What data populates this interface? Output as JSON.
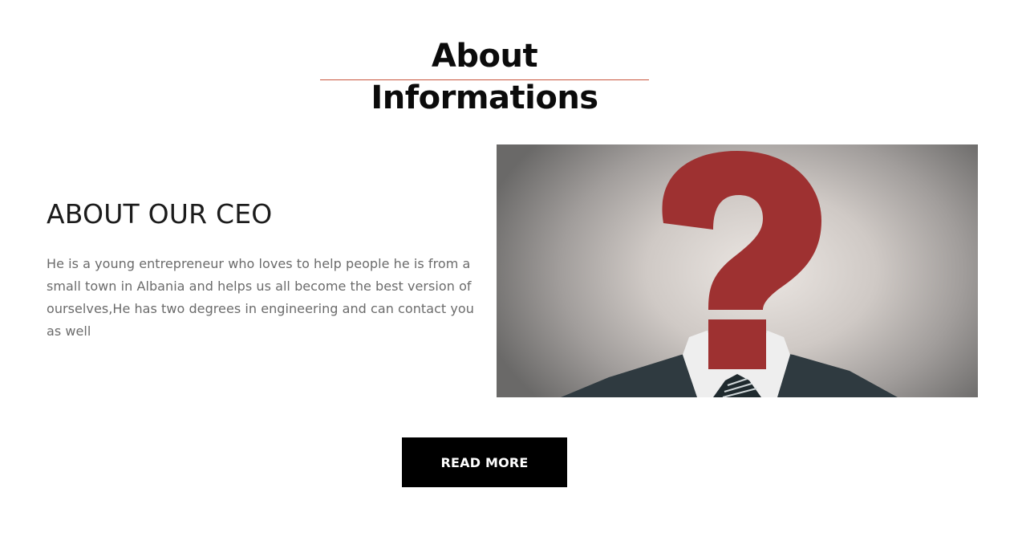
{
  "section": {
    "heading": "About Informations",
    "accent_color": "#c8553d"
  },
  "ceo": {
    "title": "ABOUT OUR CEO",
    "description": "He is a young entrepreneur who loves to help people he is from a small town in Albania and helps us all become the best version of ourselves,He has two degrees in engineering and can contact you as well"
  },
  "image": {
    "subject": "question-mark-head-businessman",
    "question_mark_color": "#9e3131"
  },
  "cta": {
    "label": "READ MORE"
  }
}
